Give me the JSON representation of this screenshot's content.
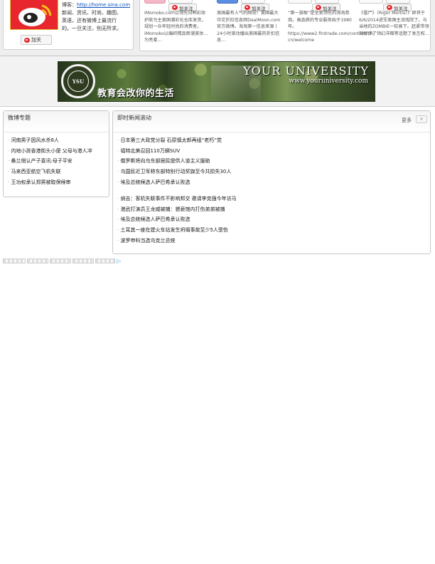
{
  "top": {
    "intro": {
      "line0": "博客：",
      "link": "http://home.sina.com",
      "line2": "新闻、资讯、时尚、趣图、",
      "line3": "英语，还有微博上最流行",
      "line4": "的。一旦关注，别无所求。"
    },
    "follow_label": "加关注",
    "big_follow_label": "加关",
    "feeds": [
      {
        "text": "iMomoko.com以领先日韩彩妆护肤为主美国潮彩化仓库发货，规划一众年轻时尚的消费者。iMomoko以编织精品新潮美妆…为亮爱…"
      },
      {
        "text": "美国最有人气的网站！美国最大中文折扣信息网DealMoon.com官方微博。海淘第一信息来源丨24小时滚动播出美国最热折扣信息…"
      },
      {
        "text": "“第一慧眼”是全美领先的海淘券商。高品质的专业服务始于1980年。https://www2.firstrade.com/content/zh-cn/welcome"
      },
      {
        "text": "《僵尸》（Rigor Mortis）》即将于6/6/2014进军美国主流戏院了。与当地的ZOMBIE一较高下。赶紧带领到好伴了领幻洋赠等话题了发言权…"
      }
    ]
  },
  "banner": {
    "seal_text": "YSU",
    "university": "YOUR UNIVERSITY",
    "url": "www.youruniversity.com",
    "slogan": "教育会改你的生活"
  },
  "weibo_topics": {
    "title": "微博专题",
    "items": [
      "河南男子因风水杀8人",
      "内地小孩香港街头小便 父母与港人冲",
      "桑兰俏认产子喜讯:母子平安",
      "马来西亚航空飞机失联",
      "王功权承认郑男被取保候审"
    ]
  },
  "news": {
    "title": "即时新闻滚动",
    "more_label": "更多",
    "close_label": "×",
    "group_a": [
      "日本第三大政党分裂 石原慎太郎再组“老朽”党",
      "福特北美召回110万辆SUV",
      "俄罗斯将向乌东部居民提供人道主义援助",
      "乌国民近卫军称东部特别行动奖旗至今共损失30人",
      "埃及总统候选人萨巴希承认败选"
    ],
    "group_b": [
      "纳吉：客机失联事件不影响邦交 邀请李克强今年访马",
      "港武打演员王龙威被捕：猥亵馆内打伤弟弟被捕",
      "埃及总统候选人萨巴希承认败选",
      "土耳其一座在建火车站发生坍塌事故至少5人受伤",
      "波罗申科当选乌克兰总统"
    ]
  }
}
